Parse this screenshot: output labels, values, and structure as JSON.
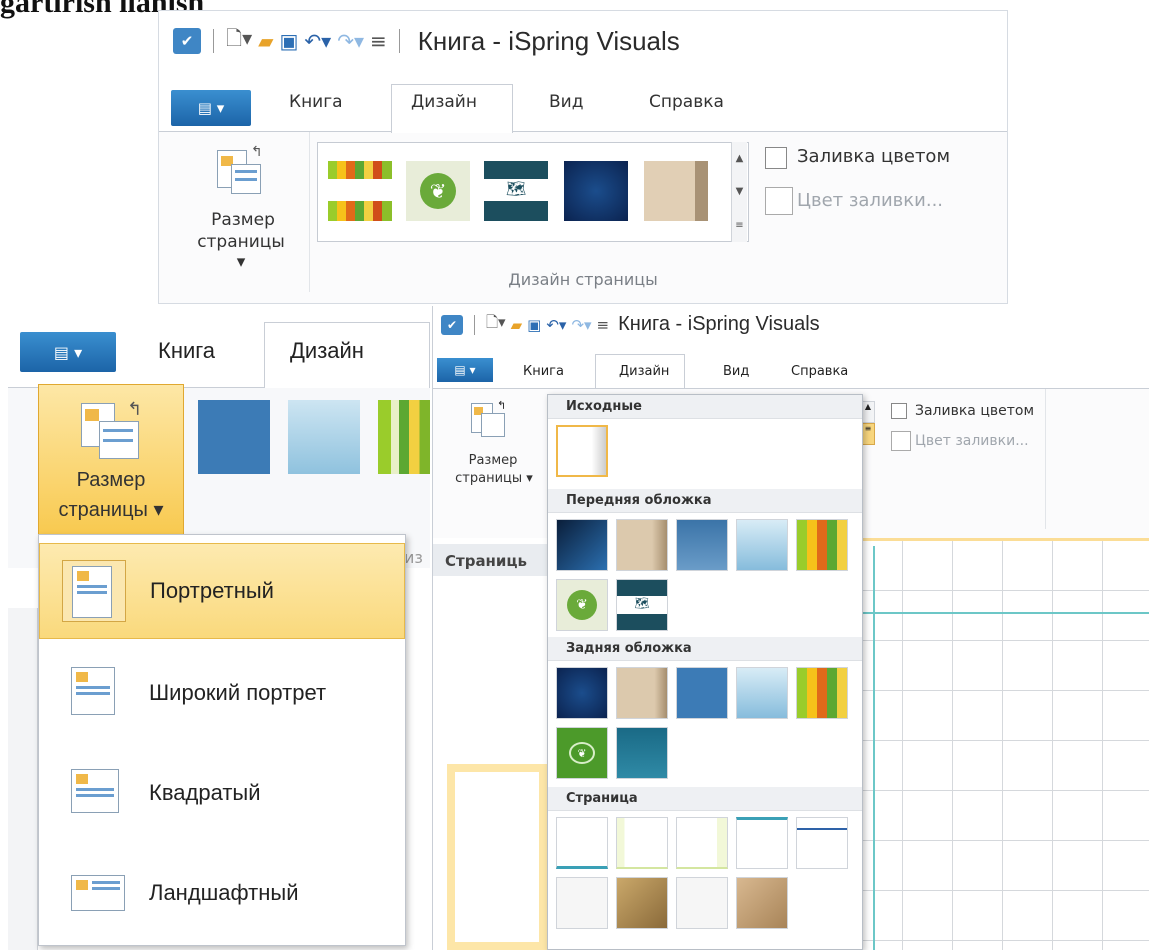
{
  "caption": {
    "text": "gartirish ilanish"
  },
  "shot1": {
    "title": "Книга - iSpring Visuals",
    "file_tab": "▤ ▾",
    "tabs": [
      "Книга",
      "Дизайн",
      "Вид",
      "Справка"
    ],
    "page_size_label1": "Размер",
    "page_size_label2": "страницы ▾",
    "fill_checkbox": "Заливка цветом",
    "fill_color": "Цвет заливки...",
    "group_label": "Дизайн страницы"
  },
  "shot2": {
    "file_tab": "▤ ▾",
    "tabs": [
      "Книга",
      "Дизайн"
    ],
    "page_size_label1": "Размер",
    "page_size_label2": "страницы ▾",
    "partial_text": "из",
    "menu_items": [
      "Портретный",
      "Широкий портрет",
      "Квадратый",
      "Ландшафтный"
    ]
  },
  "shot3": {
    "title": "Книга - iSpring Visuals",
    "file_tab": "▤ ▾",
    "tabs": [
      "Книга",
      "Дизайн",
      "Вид",
      "Справка"
    ],
    "page_size_label1": "Размер",
    "page_size_label2": "страницы ▾",
    "fill_checkbox": "Заливка цветом",
    "fill_color": "Цвет заливки...",
    "pages_label": "Страниць",
    "sections": [
      "Исходные",
      "Передняя обложка",
      "Задняя обложка",
      "Страница"
    ]
  },
  "colors": {
    "accent": "#2d7fc1",
    "hover": "#fbd37a",
    "panel": "#f7f8fa"
  }
}
